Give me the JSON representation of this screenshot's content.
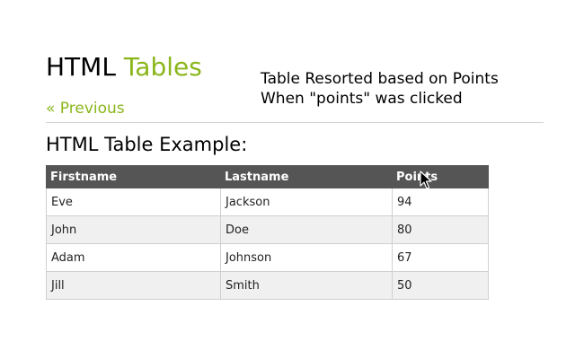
{
  "header": {
    "title_part1": "HTML",
    "title_part2": "Tables"
  },
  "annotation": {
    "line1": "Table Resorted based on Points",
    "line2": "When \"points\" was clicked"
  },
  "nav": {
    "previous_label": "« Previous"
  },
  "section": {
    "heading": "HTML Table Example:"
  },
  "table": {
    "headers": [
      "Firstname",
      "Lastname",
      "Points"
    ],
    "rows": [
      [
        "Eve",
        "Jackson",
        "94"
      ],
      [
        "John",
        "Doe",
        "80"
      ],
      [
        "Adam",
        "Johnson",
        "67"
      ],
      [
        "Jill",
        "Smith",
        "50"
      ]
    ]
  },
  "colors": {
    "accent": "#8ab61b",
    "header_bg": "#555555",
    "row_alt_bg": "#f0f0f0"
  },
  "icons": {
    "cursor": "mouse-pointer-icon"
  }
}
